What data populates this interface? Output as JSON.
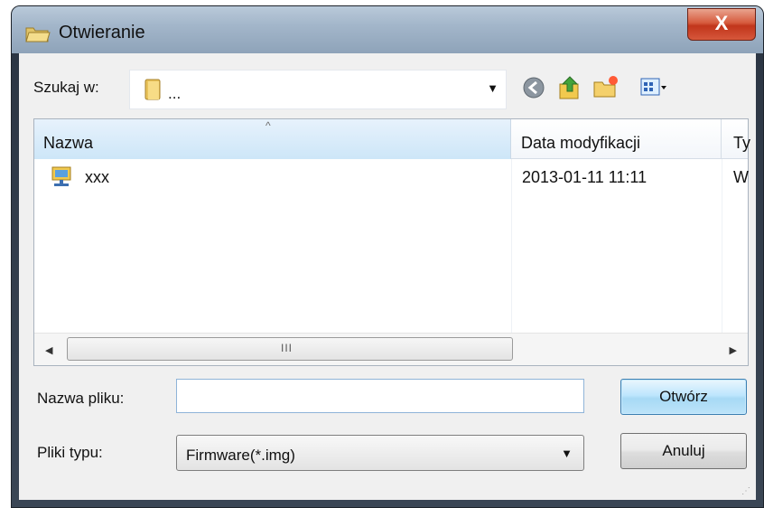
{
  "window": {
    "title": "Otwieranie",
    "close_label": "X"
  },
  "lookin": {
    "label": "Szukaj w:",
    "value": "..."
  },
  "toolbar": {
    "icons": [
      "back-icon",
      "up-folder-icon",
      "new-folder-icon",
      "view-menu-icon"
    ]
  },
  "list": {
    "columns": [
      "Nazwa",
      "Data modyfikacji",
      "Ty"
    ],
    "rows": [
      {
        "name": "xxx",
        "date": "2013-01-11 11:11",
        "type": "W"
      }
    ],
    "scroll_grip": "III"
  },
  "form": {
    "filename_label": "Nazwa pliku:",
    "filename_value": "",
    "filetype_label": "Pliki typu:",
    "filetype_value": "Firmware(*.img)"
  },
  "buttons": {
    "open": "Otwórz",
    "cancel": "Anuluj"
  },
  "colors": {
    "accent": "#3c7fb1",
    "close": "#c1351b"
  }
}
